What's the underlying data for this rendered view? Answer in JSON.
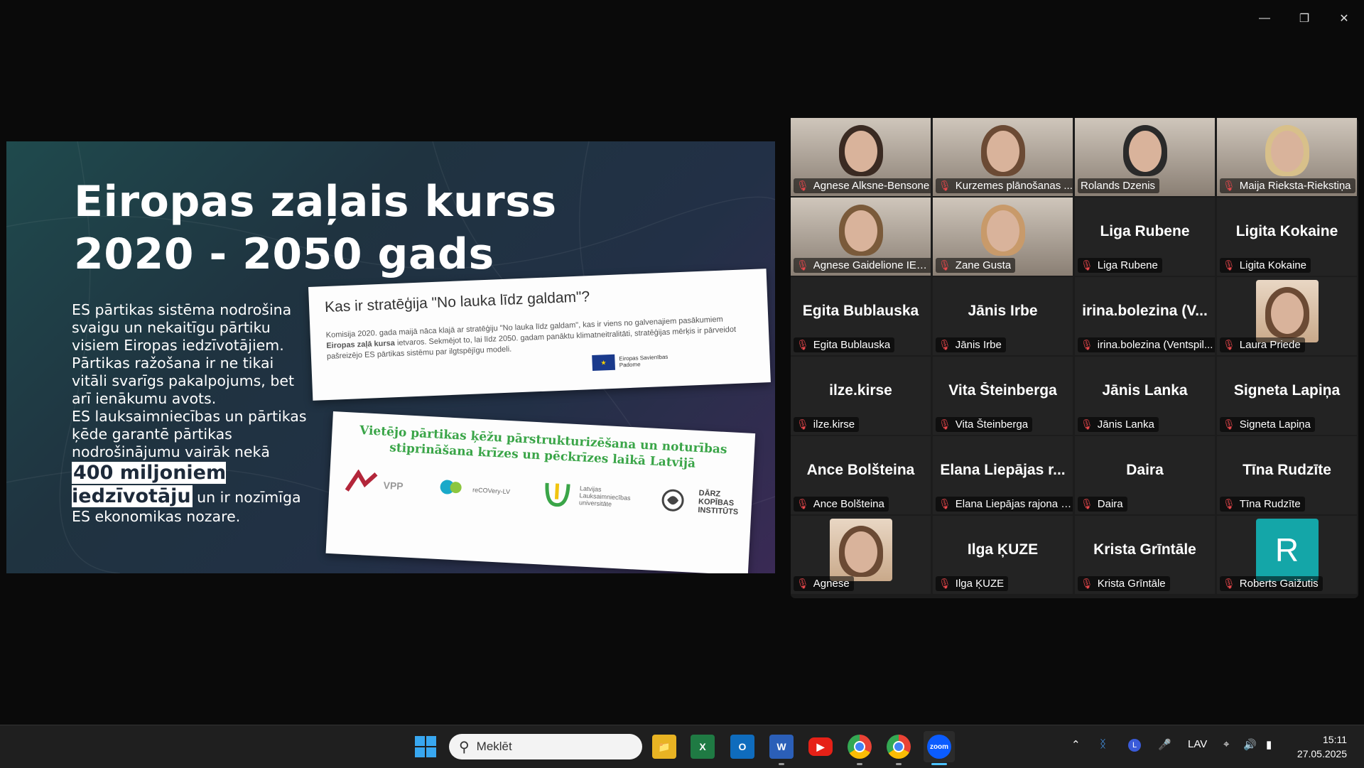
{
  "window": {
    "controls": [
      "minimize",
      "restore",
      "close"
    ]
  },
  "slide": {
    "title_line1": "Eiropas zaļais kurss",
    "title_line2": "2020 - 2050 gads",
    "body_p1": "ES pārtikas sistēma nodrošina svaigu un nekaitīgu pārtiku visiem Eiropas iedzīvotājiem. Pārtikas ražošana ir ne tikai vitāli svarīgs pakalpojums, bet arī ienākumu avots.",
    "body_p2": "ES lauksaimniecības un pārtikas ķēde garantē pārtikas nodrošinājumu vairāk nekā",
    "highlight": "400 miljoniem iedzīvotāju",
    "body_p3": "un ir nozīmīga ES ekonomikas nozare.",
    "card1": {
      "question": "Kas ir stratēģija \"No lauka līdz galdam\"?",
      "text_a": "Komisija 2020. gada maijā nāca klajā ar stratēģiju \"No lauka līdz galdam\", kas ir viens no galvenajiem pasākumiem",
      "text_bold": "Eiropas zaļā kursa",
      "text_b": "ietvaros. Sekmējot to, lai līdz 2050. gadam panāktu klimatneitralitāti, stratēģijas mērķis ir pārveidot pašreizējo ES pārtikas sistēmu par ilgtspējīgu modeli.",
      "eu_label": "Eiropas Savienības Padome"
    },
    "card2": {
      "headline": "Vietējo pārtikas ķēžu pārstrukturizēšana un noturības stiprināšana krīzes un pēckrīzes laikā Latvijā",
      "logos": [
        "VPP",
        "reCOVery-LV",
        "Latvijas Lauksaimniecības universitāte",
        "DĀRZ KOPĪBAS INSTITŪTS"
      ]
    }
  },
  "participants": [
    {
      "name": "Agnese Alksne-Bensone",
      "label": "Agnese Alksne-Bensone",
      "video": true,
      "active": false,
      "muted": true
    },
    {
      "name": "Kurzemes plānošanas ...",
      "label": "Kurzemes plānošanas ...",
      "video": true,
      "active": false,
      "muted": true
    },
    {
      "name": "Rolands Dzenis",
      "label": "Rolands Dzenis",
      "video": true,
      "active": true,
      "muted": false
    },
    {
      "name": "Maija Rieksta-Riekstiņa",
      "label": "Maija Rieksta-Riekstiņa",
      "video": true,
      "active": false,
      "muted": true
    },
    {
      "name": "Agnese Gaidelione IEB...",
      "label": "Agnese Gaidelione IEB...",
      "video": true,
      "active": false,
      "muted": true
    },
    {
      "name": "Zane Gusta",
      "label": "Zane Gusta",
      "video": true,
      "active": false,
      "muted": true
    },
    {
      "name": "Liga Rubene",
      "label": "Liga Rubene",
      "video": false,
      "active": false,
      "muted": true
    },
    {
      "name": "Ligita Kokaine",
      "label": "Ligita Kokaine",
      "video": false,
      "active": false,
      "muted": true
    },
    {
      "name": "Egita Bublauska",
      "label": "Egita Bublauska",
      "video": false,
      "active": false,
      "muted": true
    },
    {
      "name": "Jānis Irbe",
      "label": "Jānis Irbe",
      "video": false,
      "active": false,
      "muted": true
    },
    {
      "name": "irina.bolezina (V...",
      "label": "irina.bolezina (Ventspil...",
      "video": false,
      "active": false,
      "muted": true
    },
    {
      "name": "Laura Priede",
      "label": "Laura Priede",
      "video": false,
      "photo": true,
      "active": false,
      "muted": true
    },
    {
      "name": "ilze.kirse",
      "label": "ilze.kirse",
      "video": false,
      "active": false,
      "muted": true
    },
    {
      "name": "Vita Šteinberga",
      "label": "Vita Šteinberga",
      "video": false,
      "active": false,
      "muted": true
    },
    {
      "name": "Jānis Lanka",
      "label": "Jānis Lanka",
      "video": false,
      "active": false,
      "muted": true
    },
    {
      "name": "Signeta Lapiņa",
      "label": "Signeta Lapiņa",
      "video": false,
      "active": false,
      "muted": true
    },
    {
      "name": "Ance Bolšteina",
      "label": "Ance Bolšteina",
      "video": false,
      "active": false,
      "muted": true
    },
    {
      "name": "Elana Liepājas r...",
      "label": "Elana Liepājas rajona p...",
      "video": false,
      "active": false,
      "muted": true
    },
    {
      "name": "Daira",
      "label": "Daira",
      "video": false,
      "active": false,
      "muted": true
    },
    {
      "name": "Tīna Rudzīte",
      "label": "Tīna Rudzīte",
      "video": false,
      "active": false,
      "muted": true
    },
    {
      "name": "Agnese",
      "label": "Agnese",
      "video": false,
      "photo": true,
      "active": false,
      "muted": true
    },
    {
      "name": "Ilga ĶUZE",
      "label": "Ilga ĶUZE",
      "video": false,
      "active": false,
      "muted": true
    },
    {
      "name": "Krista Grīntāle",
      "label": "Krista Grīntāle",
      "video": false,
      "active": false,
      "muted": true
    },
    {
      "name": "Roberts Gaižutis",
      "label": "Roberts Gaižutis",
      "video": false,
      "initial": "R",
      "active": false,
      "muted": true
    }
  ],
  "taskbar": {
    "search_placeholder": "Meklēt",
    "apps": [
      "file-explorer",
      "excel",
      "outlook",
      "word",
      "youtube",
      "chrome",
      "chrome",
      "zoom"
    ],
    "tray": {
      "language": "LAV"
    },
    "time": "15:11",
    "date": "27.05.2025"
  }
}
